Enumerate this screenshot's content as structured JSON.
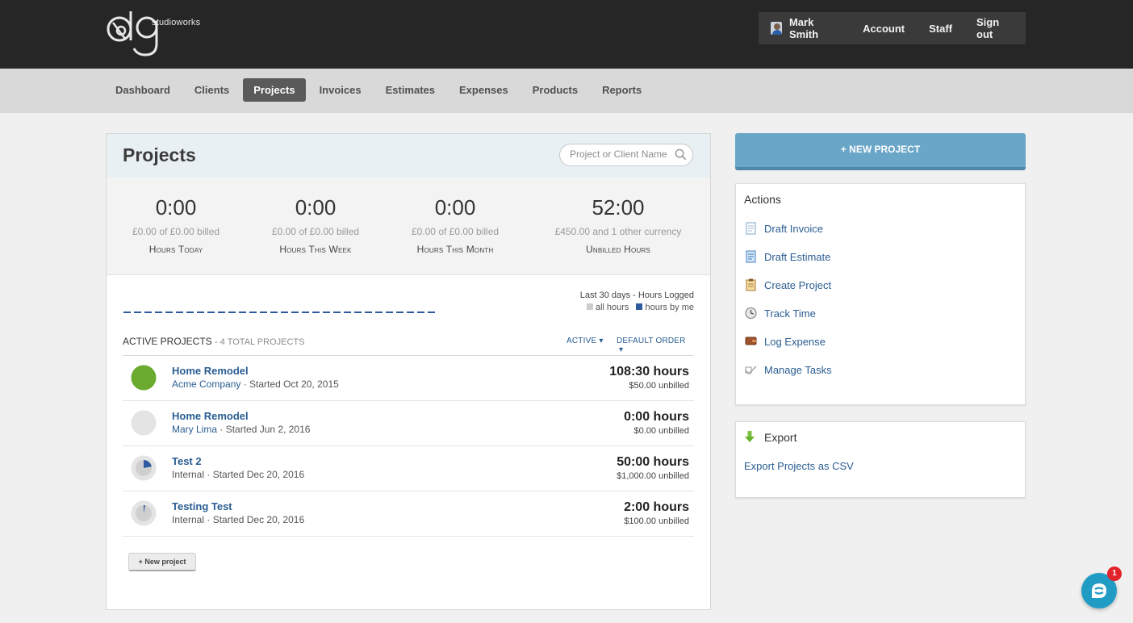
{
  "brand": {
    "logo_text": "studioworks"
  },
  "user_menu": {
    "user_name": "Mark Smith",
    "items": [
      "Account",
      "Staff",
      "Sign out"
    ]
  },
  "nav": {
    "items": [
      "Dashboard",
      "Clients",
      "Projects",
      "Invoices",
      "Estimates",
      "Expenses",
      "Products",
      "Reports"
    ],
    "active": "Projects"
  },
  "page": {
    "title": "Projects",
    "search_placeholder": "Project or Client Name"
  },
  "stats": [
    {
      "value": "0:00",
      "billed": "£0.00 of £0.00 billed",
      "label": "Hours Today"
    },
    {
      "value": "0:00",
      "billed": "£0.00 of £0.00 billed",
      "label": "Hours This Week"
    },
    {
      "value": "0:00",
      "billed": "£0.00 of £0.00 billed",
      "label": "Hours This Month"
    },
    {
      "value": "52:00",
      "billed": "£450.00 and 1 other currency",
      "label": "Unbilled Hours"
    }
  ],
  "chart_legend": {
    "title": "Last 30 days - Hours Logged",
    "all_hours": "all hours",
    "hours_by_me": "hours by me",
    "colors": {
      "all_hours": "#cccccc",
      "hours_by_me": "#2f5aa0"
    }
  },
  "active_projects": {
    "title": "ACTIVE PROJECTS",
    "total": "- 4 TOTAL PROJECTS",
    "filter_status": "ACTIVE",
    "filter_order": "DEFAULT ORDER"
  },
  "projects": [
    {
      "name": "Home Remodel",
      "client": "Acme Company",
      "started": "· Started Oct 20, 2015",
      "hours": "108:30 hours",
      "unbilled": "$50.00 unbilled",
      "progress": 1.0,
      "pie_color": "#6aaa2e"
    },
    {
      "name": "Home Remodel",
      "client": "Mary Lima",
      "started": "· Started Jun 2, 2016",
      "hours": "0:00 hours",
      "unbilled": "$0.00 unbilled",
      "progress": 0.0,
      "pie_color": "#2f5aa0"
    },
    {
      "name": "Test 2",
      "client": "Internal",
      "started": "· Started Dec 20, 2016",
      "hours": "50:00 hours",
      "unbilled": "$1,000.00 unbilled",
      "progress": 0.22,
      "pie_color": "#2f5aa0"
    },
    {
      "name": "Testing Test",
      "client": "Internal",
      "started": "· Started Dec 20, 2016",
      "hours": "2:00 hours",
      "unbilled": "$100.00 unbilled",
      "progress": 0.03,
      "pie_color": "#2f5aa0"
    }
  ],
  "new_project_small": "+ New project",
  "sidebar": {
    "new_project_button": "+ NEW PROJECT",
    "actions_title": "Actions",
    "actions": [
      {
        "label": "Draft Invoice",
        "icon": "invoice-icon"
      },
      {
        "label": "Draft Estimate",
        "icon": "estimate-icon"
      },
      {
        "label": "Create Project",
        "icon": "clipboard-icon"
      },
      {
        "label": "Track Time",
        "icon": "clock-icon"
      },
      {
        "label": "Log Expense",
        "icon": "wallet-icon"
      },
      {
        "label": "Manage Tasks",
        "icon": "tasks-icon"
      }
    ],
    "export_title": "Export",
    "export_link": "Export Projects as CSV"
  },
  "chat": {
    "badge_count": "1"
  }
}
